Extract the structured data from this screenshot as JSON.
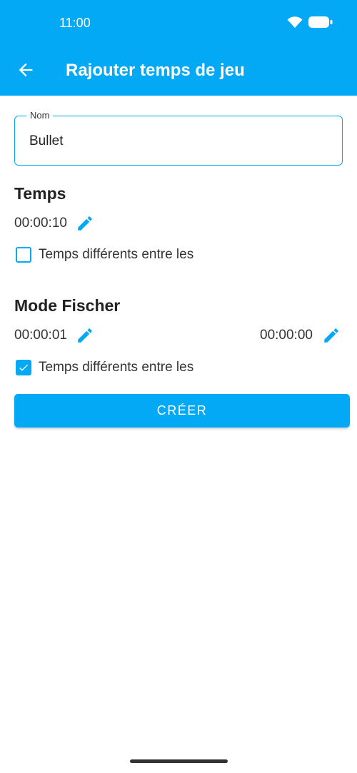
{
  "status_bar": {
    "time": "11:00",
    "icons": [
      "wifi-icon",
      "battery-icon"
    ]
  },
  "app_bar": {
    "title": "Rajouter temps de jeu",
    "back_icon": "arrow-back-icon"
  },
  "name_field": {
    "label": "Nom",
    "value": "Bullet"
  },
  "time_section": {
    "title": "Temps",
    "value": "00:00:10",
    "different_times_checkbox": {
      "label": "Temps différents entre les",
      "checked": false
    }
  },
  "fischer_section": {
    "title": "Mode Fischer",
    "value_left": "00:00:01",
    "value_right": "00:00:00",
    "different_times_checkbox": {
      "label": "Temps différents entre les",
      "checked": true
    }
  },
  "create_button": {
    "label": "CRÉER"
  },
  "colors": {
    "primary": "#03A9F4",
    "text": "#222222",
    "background": "#ffffff"
  }
}
